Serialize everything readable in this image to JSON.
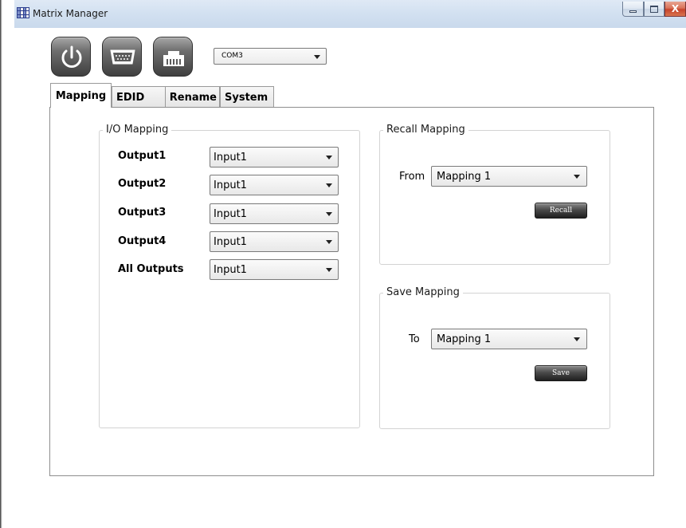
{
  "window": {
    "title": "Matrix Manager",
    "controls": {
      "minimize": "minimize",
      "maximize": "maximize",
      "close": "X"
    }
  },
  "toolbar": {
    "icons": [
      "power-icon",
      "serial-port-icon",
      "lan-port-icon"
    ],
    "com_port": "COM3"
  },
  "tabs": [
    {
      "label": "Mapping",
      "active": true
    },
    {
      "label": "EDID",
      "active": false
    },
    {
      "label": "Rename",
      "active": false
    },
    {
      "label": "System",
      "active": false
    }
  ],
  "io_mapping": {
    "title": "I/O Mapping",
    "rows": [
      {
        "output": "Output1",
        "input": "Input1"
      },
      {
        "output": "Output2",
        "input": "Input1"
      },
      {
        "output": "Output3",
        "input": "Input1"
      },
      {
        "output": "Output4",
        "input": "Input1"
      },
      {
        "output": "All Outputs",
        "input": "Input1"
      }
    ]
  },
  "recall_mapping": {
    "title": "Recall Mapping",
    "from_label": "From",
    "selected": "Mapping 1",
    "button_label": "Recall"
  },
  "save_mapping": {
    "title": "Save Mapping",
    "to_label": "To",
    "selected": "Mapping 1",
    "button_label": "Save"
  }
}
